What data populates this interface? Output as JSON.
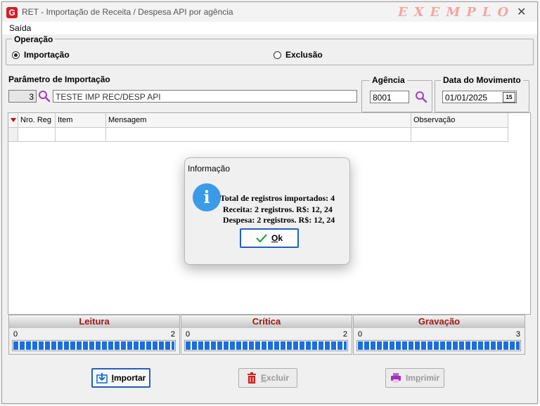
{
  "window": {
    "title": "RET - Importação de Receita / Despesa API por agência",
    "watermark": "EXEMPLO",
    "close_glyph": "✕",
    "icon_letter": "G"
  },
  "menu": {
    "items": [
      "Saída"
    ]
  },
  "operacao": {
    "label": "Operação",
    "options": [
      {
        "label": "Importação",
        "selected": true
      },
      {
        "label": "Exclusão",
        "selected": false
      }
    ]
  },
  "parametro": {
    "label": "Parâmetro de Importação",
    "code": "3",
    "description": "TESTE IMP REC/DESP API"
  },
  "agencia": {
    "label": "Agência",
    "value": "8001"
  },
  "data_movimento": {
    "label": "Data do Movimento",
    "value": "01/01/2025",
    "calendar_glyph": "15"
  },
  "grid": {
    "columns": [
      "Nro. Reg",
      "Item",
      "Mensagem",
      "Observação"
    ]
  },
  "progress": [
    {
      "label": "Leitura",
      "min": "0",
      "max": "2",
      "fraction": 1.0
    },
    {
      "label": "Crítica",
      "min": "0",
      "max": "2",
      "fraction": 1.0
    },
    {
      "label": "Gravação",
      "min": "0",
      "max": "3",
      "fraction": 1.0
    }
  ],
  "buttons": {
    "importar": {
      "prefix": "",
      "accel": "I",
      "rest": "mportar"
    },
    "excluir": {
      "prefix": "",
      "accel": "E",
      "rest": "xcluir"
    },
    "imprimir": {
      "prefix": "Im",
      "accel": "p",
      "rest": "rimir"
    }
  },
  "dialog": {
    "title": "Informação",
    "icon_glyph": "i",
    "lines": [
      "Total de registros importados: 4",
      "Receita: 2 registros. R$: 12, 24",
      "Despesa: 2 registros. R$: 12, 24"
    ],
    "ok_accel": "O",
    "ok_rest": "k"
  },
  "colors": {
    "accent_blue": "#2060c0",
    "progress_fill": "#1a6fe0",
    "header_red": "#a01818",
    "watermark": "#f3a6a6"
  }
}
